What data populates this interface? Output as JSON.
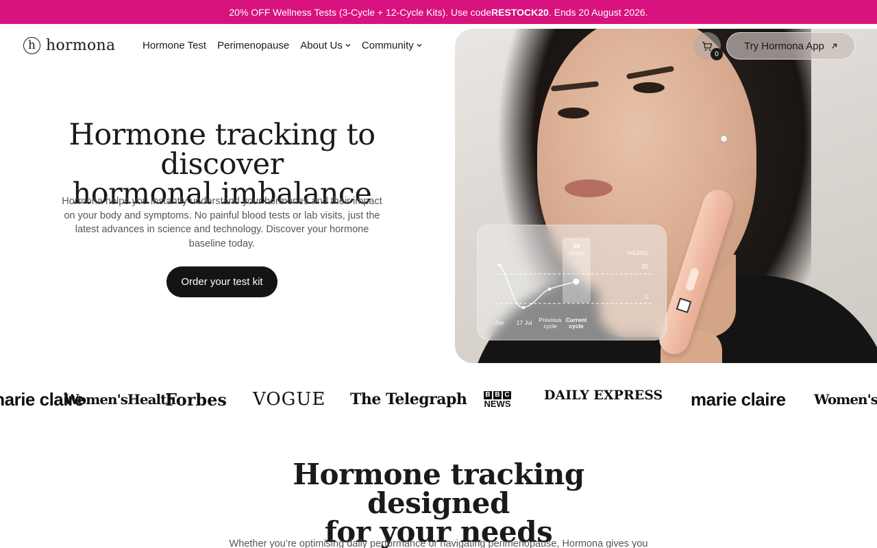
{
  "promo": {
    "text_before": "20% OFF Wellness Tests (3-Cycle + 12-Cycle Kits). Use code ",
    "code": "RESTOCK20",
    "text_after": ". Ends 20 August 2026.",
    "background": "#d8127f"
  },
  "brand": {
    "name": "hormona",
    "icon": "hormona-logo-icon"
  },
  "nav": {
    "items": [
      {
        "label": "Hormone Test",
        "dropdown": false
      },
      {
        "label": "Perimenopause",
        "dropdown": false
      },
      {
        "label": "About Us",
        "dropdown": true
      },
      {
        "label": "Community",
        "dropdown": true
      }
    ]
  },
  "header_actions": {
    "cart_icon": "cart-icon",
    "cart_count": "0",
    "app_button_label": "Try Hormona App",
    "app_button_icon": "arrow-up-right-icon"
  },
  "hero": {
    "title_line1": "Hormone tracking to discover",
    "title_line2": "hormonal imbalance",
    "subtitle": "Hormona helps you instantly understand your hormones and their impact on your body and symptoms. No painful blood tests or lab visits, just the latest advances in science and technology. Discover your hormone baseline today.",
    "cta_label": "Order your test kit"
  },
  "hero_chart": {
    "unit": "mIU/mL",
    "tooltip_value": "20",
    "tooltip_unit": "mIU/mL",
    "y_ticks": [
      "30",
      "1"
    ],
    "x_labels": [
      "Jun",
      "17 Jul",
      "Previous cycle",
      "Current cycle"
    ]
  },
  "press_logos": [
    "marie claire",
    "Women'sHealth",
    "Forbes",
    "VOGUE",
    "The Telegraph",
    "BBC NEWS",
    "DAILY EXPRESS",
    "marie claire",
    "Women'sHealth"
  ],
  "section2": {
    "title_line1": "Hormone tracking designed",
    "title_line2": "for your needs",
    "subtitle": "Whether you’re optimising daily performance or navigating perimenopause, Hormona gives you"
  }
}
